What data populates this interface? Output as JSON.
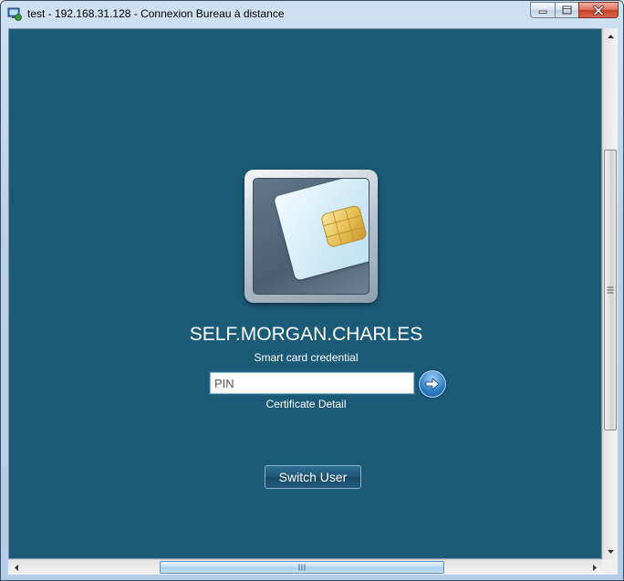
{
  "window": {
    "title": "test - 192.168.31.128 - Connexion Bureau à distance",
    "app_icon": "remote-desktop-icon",
    "buttons": [
      "minimize-icon",
      "maximize-icon",
      "close-icon"
    ]
  },
  "login": {
    "tile_icon": "smart-card-icon",
    "user_name": "SELF.MORGAN.CHARLES",
    "credential_type": "Smart card credential",
    "pin": {
      "value": "",
      "placeholder": "PIN"
    },
    "submit_icon": "arrow-right-icon",
    "certificate_link": "Certificate Detail",
    "switch_user_label": "Switch User"
  },
  "colors": {
    "desktop_background": "#1c5b78",
    "frame": "#b9d1ea",
    "close_button": "#c3412a",
    "submit_button": "#2d7fc6"
  }
}
